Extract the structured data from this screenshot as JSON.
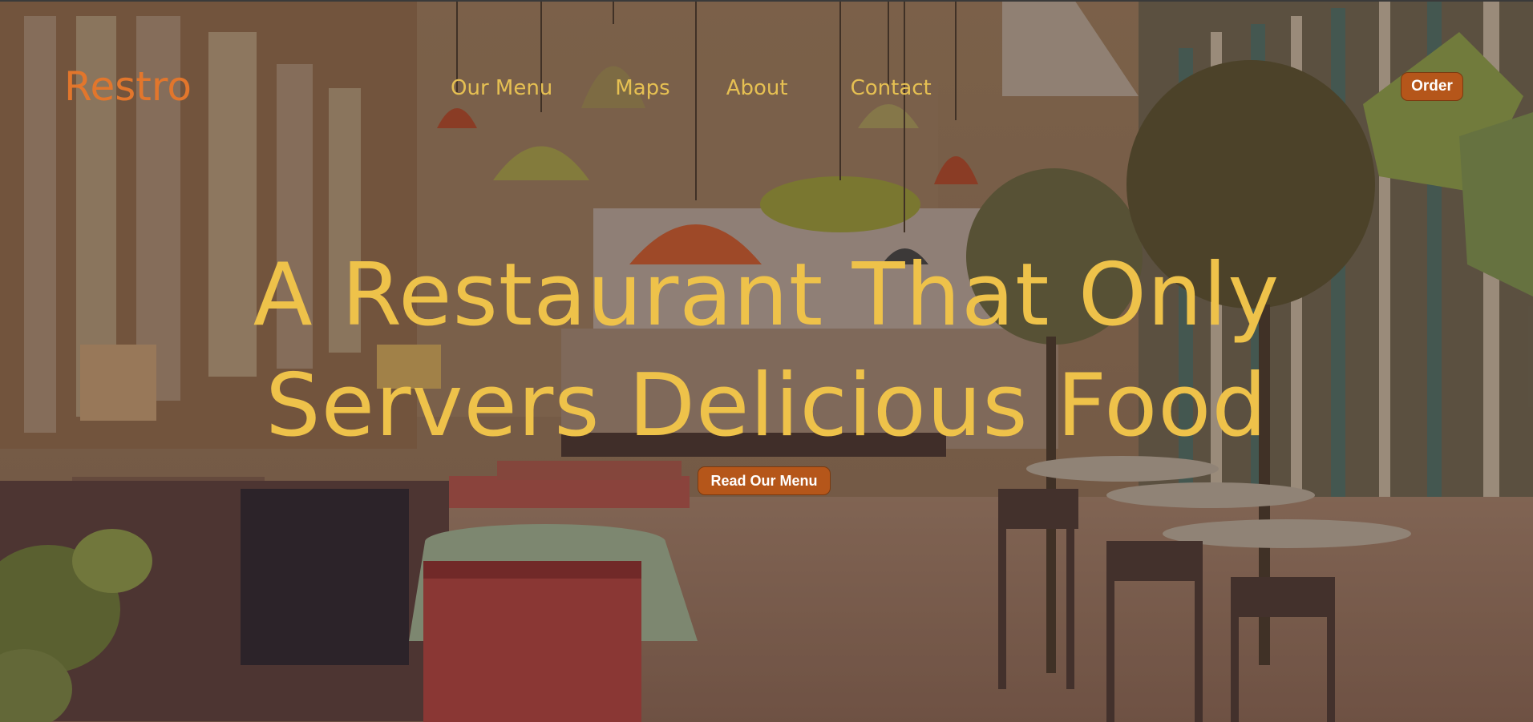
{
  "brand": {
    "logo_text": "Restro"
  },
  "nav": {
    "links": [
      {
        "label": "Our Menu"
      },
      {
        "label": "Maps"
      },
      {
        "label": "About"
      },
      {
        "label": "Contact"
      }
    ],
    "order_label": "Order"
  },
  "hero": {
    "title_line_1": "A Restaurant That Only",
    "title_line_2": "Servers Delicious Food",
    "cta_label": "Read Our Menu"
  },
  "colors": {
    "logo": "#e2762c",
    "nav_text": "#e6c052",
    "hero_text": "#eec24a",
    "button_bg": "#b5561a",
    "button_text": "#ffffff"
  },
  "background": {
    "icon": "restaurant-interior-illustration"
  }
}
